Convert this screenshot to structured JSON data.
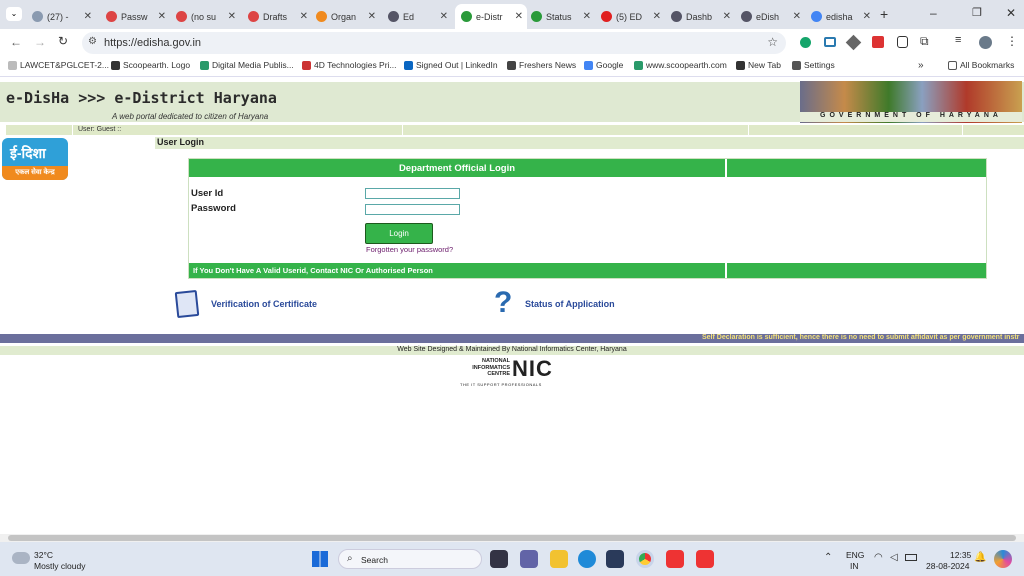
{
  "browser": {
    "tabs": [
      {
        "label": "(27) -",
        "color": "#8a9ab0"
      },
      {
        "label": "Passw",
        "color": "#d44"
      },
      {
        "label": "(no su",
        "color": "#d44"
      },
      {
        "label": "Drafts",
        "color": "#d44"
      },
      {
        "label": "Organ",
        "color": "#f08a1e"
      },
      {
        "label": "Ed",
        "color": "#556"
      },
      {
        "label": "e-Distr",
        "color": "#2a9a3a"
      },
      {
        "label": "Status",
        "color": "#2a9a3a"
      },
      {
        "label": "(5) ED",
        "color": "#e02020"
      },
      {
        "label": "Dashb",
        "color": "#556"
      },
      {
        "label": "eDish",
        "color": "#556"
      },
      {
        "label": "edisha",
        "color": "#4285f4"
      }
    ],
    "url": "https://edisha.gov.in",
    "bookmarks": [
      "LAWCET&PGLCET-2...",
      "Scoopearth. Logo",
      "Digital Media Publis...",
      "4D Technologies Pri...",
      "Signed Out | LinkedIn",
      "Freshers News",
      "Google",
      "www.scoopearth.com",
      "New Tab",
      "Settings"
    ],
    "all_bookmarks": "All Bookmarks"
  },
  "site": {
    "logo_text": "e-DisHa >>> e-District Haryana",
    "tagline": "A web portal dedicated to citizen of Haryana",
    "gov_text": "GOVERNMENT OF HARYANA",
    "user_label": "User: Guest ::",
    "section_title": "User Login",
    "edisha_logo_top": "ई-दिशा",
    "edisha_logo_bottom": "एकल सेवा केन्द्र",
    "panel_title": "Department Official Login",
    "userid_label": "User Id",
    "password_label": "Password",
    "login_button": "Login",
    "forgot_link": "Forgotten your password?",
    "panel_footer": "If You Don't Have A Valid Userid, Contact NIC Or Authorised Person",
    "verify_link": "Verification of Certificate",
    "status_link": "Status of Application",
    "marquee_text": "Self Declaration is sufficient, hence there is no need to submit affidavit as per government instr",
    "footer_text": "Web Site Designed & Maintained By National Informatics Center, Haryana",
    "nic_line1": "NATIONAL",
    "nic_line2": "INFORMATICS",
    "nic_line3": "CENTRE",
    "nic_logo": "NIC",
    "nic_tagline": "THE IT SUPPORT PROFESSIONALS"
  },
  "taskbar": {
    "weather_temp": "32°C",
    "weather_desc": "Mostly cloudy",
    "search": "Search",
    "lang1": "ENG",
    "lang2": "IN",
    "time": "12:35",
    "date": "28-08-2024"
  }
}
